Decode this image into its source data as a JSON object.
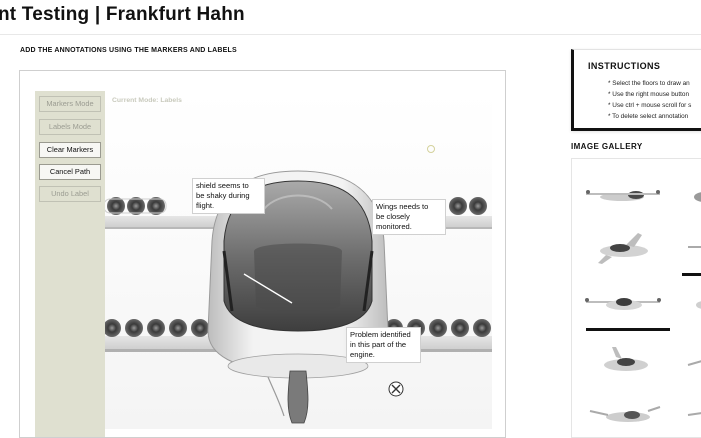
{
  "page": {
    "title": "nt Testing | Frankfurt Hahn"
  },
  "annotator": {
    "heading": "ADD THE ANNOTATIONS USING THE MARKERS AND LABELS",
    "mode_label": "Current Mode: Labels",
    "tools": [
      {
        "label": "Markers Mode",
        "enabled": false
      },
      {
        "label": "Labels Mode",
        "enabled": false
      },
      {
        "label": "Clear Markers",
        "enabled": true
      },
      {
        "label": "Cancel Path",
        "enabled": true
      },
      {
        "label": "Undo Label",
        "enabled": false
      }
    ],
    "annotations": [
      {
        "lines": [
          "shield seems to",
          "be shaky during",
          "flight."
        ]
      },
      {
        "lines": [
          "Wings needs to",
          "be closely",
          "monitored."
        ]
      },
      {
        "lines": [
          "Problem identified",
          "in this part of the",
          "engine."
        ]
      }
    ]
  },
  "instructions": {
    "title": "INSTRUCTIONS",
    "items": [
      "* Select the floors to draw an",
      "* Use the right mouse button",
      "* Use ctrl + mouse scroll for s",
      "* To delete select annotation"
    ]
  },
  "gallery": {
    "title": "IMAGE GALLERY",
    "selected_index": 3
  },
  "colors": {
    "panel": "#dfe0d0",
    "accent": "#111111",
    "marker_ring": "#d4d29c"
  }
}
